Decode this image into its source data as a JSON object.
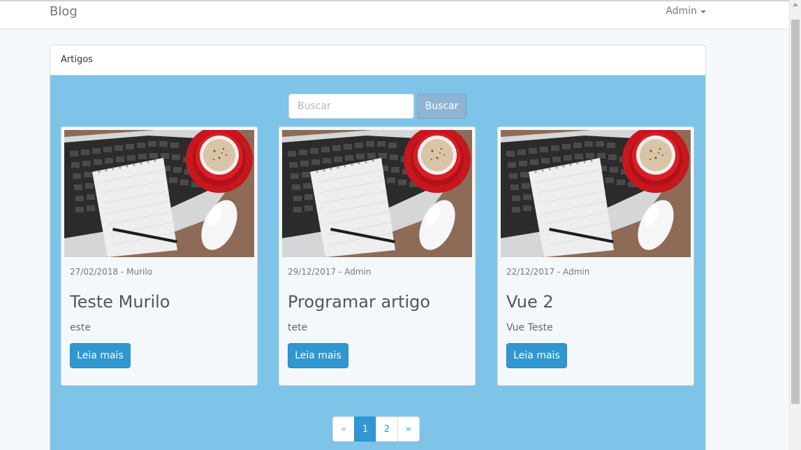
{
  "navbar": {
    "brand": "Blog",
    "user": "Admin"
  },
  "panel": {
    "heading": "Artigos"
  },
  "search": {
    "placeholder": "Buscar",
    "button_label": "Buscar"
  },
  "articles": [
    {
      "meta": "27/02/2018 - Murilo",
      "title": "Teste Murilo",
      "excerpt": "este",
      "button_label": "Leia mais"
    },
    {
      "meta": "29/12/2017 - Admin",
      "title": "Programar artigo",
      "excerpt": "tete",
      "button_label": "Leia mais"
    },
    {
      "meta": "22/12/2017 - Admin",
      "title": "Vue 2",
      "excerpt": "Vue Teste",
      "button_label": "Leia mais"
    }
  ],
  "pagination": {
    "prev": "«",
    "pages": [
      "1",
      "2"
    ],
    "current": "1",
    "next": "»"
  },
  "colors": {
    "panel_body": "#7dc4e8",
    "primary": "#3097d1",
    "search_button": "#8eb4d4"
  }
}
